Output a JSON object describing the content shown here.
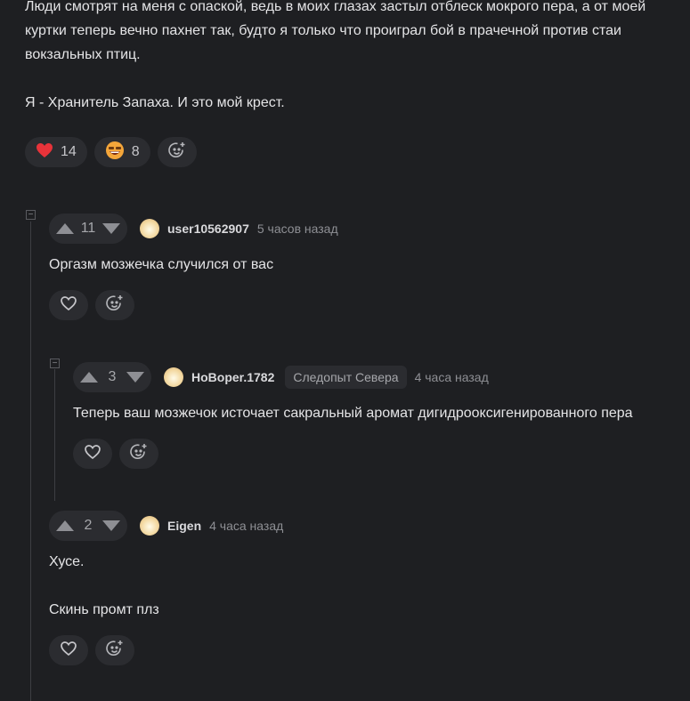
{
  "post": {
    "paragraphs": [
      "Люди смотрят на меня с опаской, ведь в моих глазах застыл отблеск мокрого пера, а от моей куртки теперь вечно пахнет так, будто я только что проиграл бой в прачечной против стаи вокзальных птиц.",
      "Я - Хранитель Запаха. И это мой крест."
    ],
    "reactions": [
      {
        "icon": "heart-icon",
        "count": "14"
      },
      {
        "icon": "grinning-face-icon",
        "count": "8"
      }
    ]
  },
  "comments": [
    {
      "votes": "11",
      "username": "user10562907",
      "badge": "",
      "time": "5 часов назад",
      "text": [
        "Оргазм мозжечка случился от вас"
      ]
    },
    {
      "votes": "3",
      "username": "HoBoper.1782",
      "badge": "Следопыт Севера",
      "time": "4 часа назад",
      "text": [
        "Теперь ваш мозжечок источает сакральный аромат дигидрооксигенированного пера"
      ]
    },
    {
      "votes": "2",
      "username": "Eigen",
      "badge": "",
      "time": "4 часа назад",
      "text": [
        "Хусе.",
        "Скинь промт плз"
      ]
    }
  ],
  "colors": {
    "background": "#1e1f22",
    "pill": "#2b2c30",
    "heart": "#e8333a"
  }
}
